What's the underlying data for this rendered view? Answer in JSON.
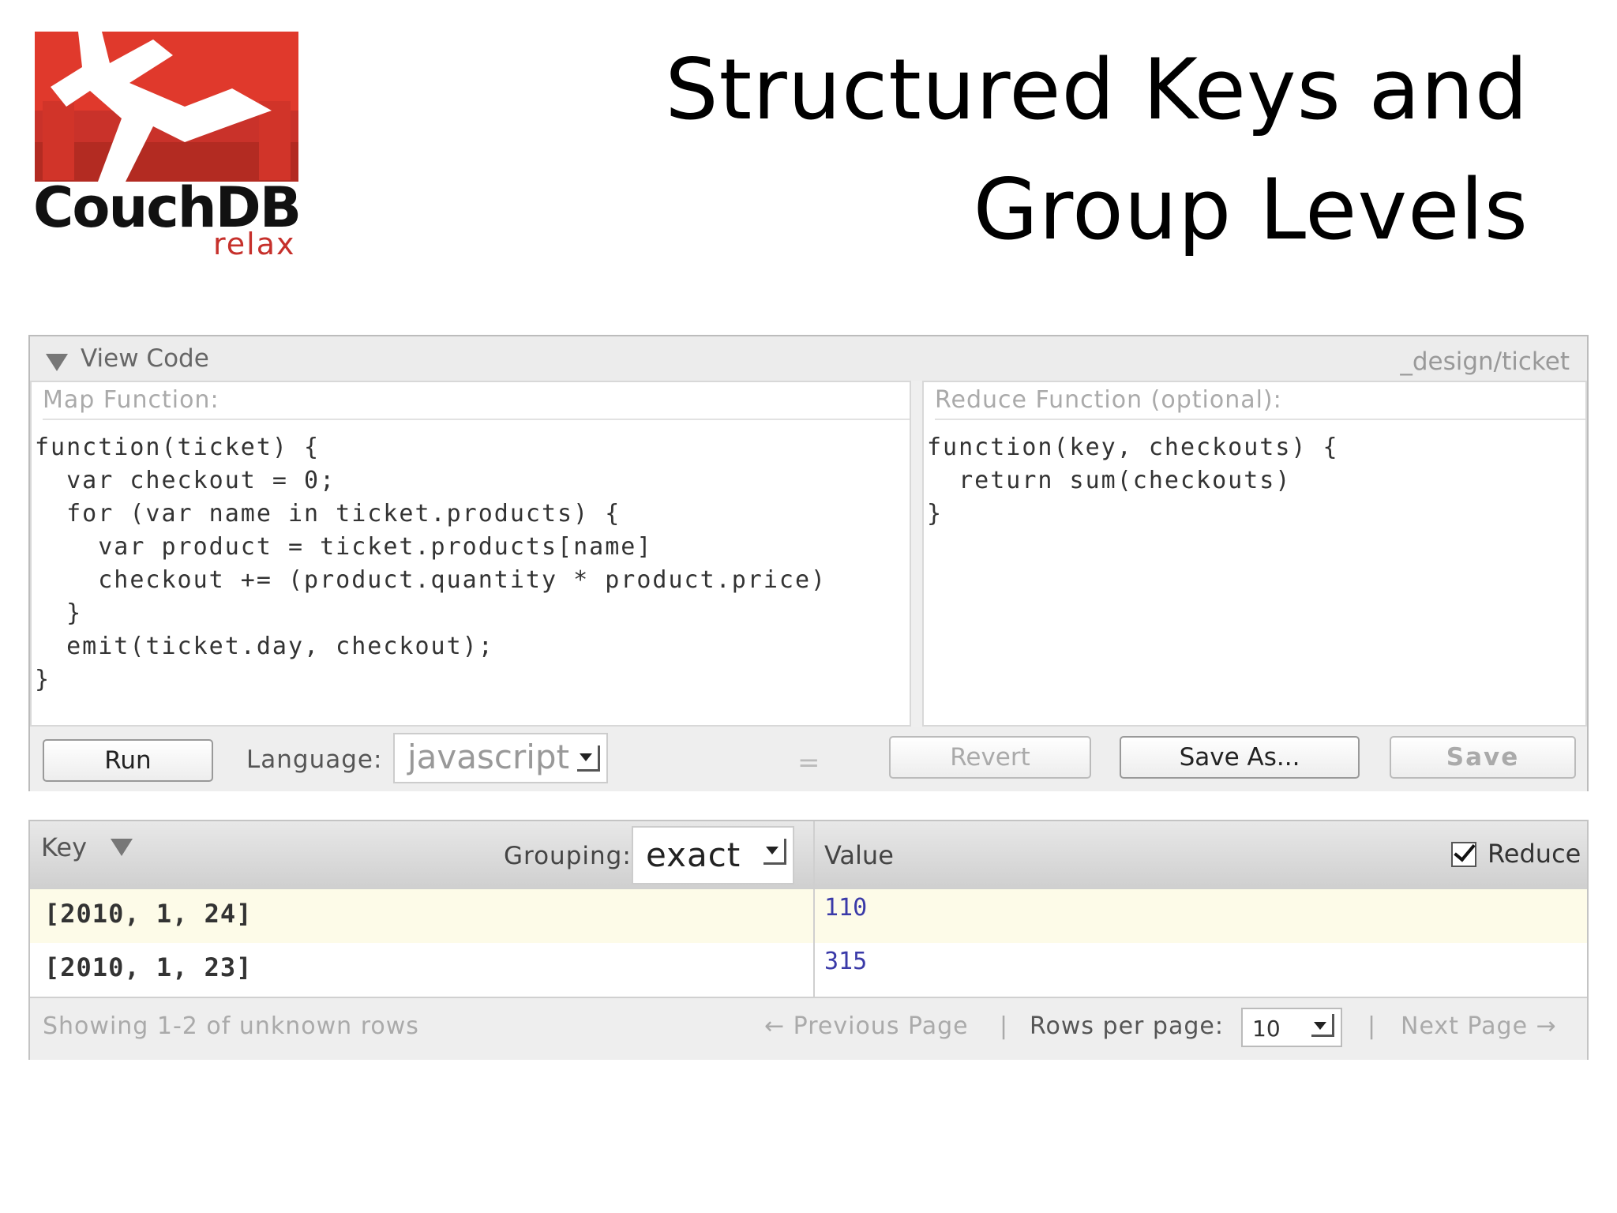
{
  "logo": {
    "wordmark": "CouchDB",
    "tagline": "relax",
    "colors": {
      "brand_red": "#e0392c",
      "dark_red": "#b32b22"
    }
  },
  "slide": {
    "title_line1": "Structured Keys and",
    "title_line2": "Group Levels"
  },
  "view_code": {
    "toggle_label": "View Code",
    "design_doc": "_design/ticket",
    "map_label": "Map Function:",
    "map_code": "function(ticket) {\n  var checkout = 0;\n  for (var name in ticket.products) {\n    var product = ticket.products[name]\n    checkout += (product.quantity * product.price)\n  }\n  emit(ticket.day, checkout);\n}",
    "reduce_label": "Reduce Function (optional):",
    "reduce_code": "function(key, checkouts) {\n  return sum(checkouts)\n}",
    "run_label": "Run",
    "language_label": "Language:",
    "language_value": "javascript",
    "equals_icon": "=",
    "revert_label": "Revert",
    "save_as_label": "Save As...",
    "save_label": "Save"
  },
  "results": {
    "key_label": "Key",
    "grouping_label": "Grouping:",
    "grouping_value": "exact",
    "value_label": "Value",
    "reduce_label": "Reduce",
    "reduce_checked": true,
    "rows": [
      {
        "key": "[2010, 1, 24]",
        "value": "110"
      },
      {
        "key": "[2010, 1, 23]",
        "value": "315"
      }
    ],
    "status": "Showing 1-2 of unknown rows",
    "prev_label": "← Previous Page",
    "separator": "|",
    "rows_per_page_label": "Rows per page:",
    "rows_per_page_value": "10",
    "next_label": "Next Page →"
  }
}
